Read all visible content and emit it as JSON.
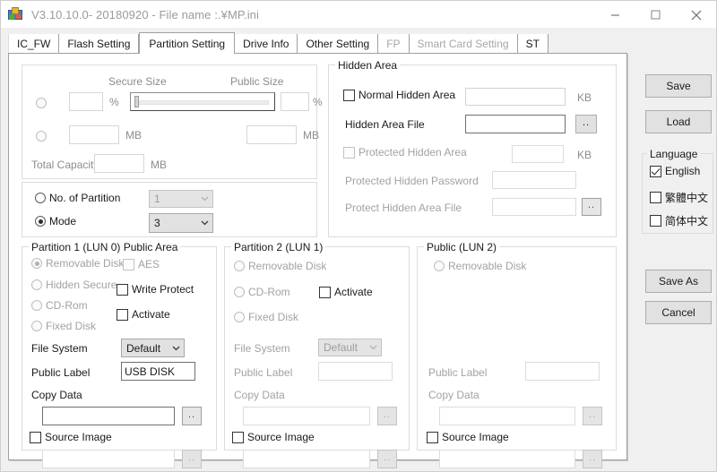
{
  "window": {
    "title": "V3.10.10.0- 20180920 - File name :.¥MP.ini",
    "app_icon": "usb-tool-icon",
    "minimize_label": "minimize-icon",
    "maximize_label": "maximize-icon",
    "close_label": "close-icon"
  },
  "tabs": [
    {
      "label": "IC_FW",
      "active": false,
      "disabled": false
    },
    {
      "label": "Flash Setting",
      "active": false,
      "disabled": false
    },
    {
      "label": "Partition Setting",
      "active": true,
      "disabled": false
    },
    {
      "label": "Drive Info",
      "active": false,
      "disabled": false
    },
    {
      "label": "Other Setting",
      "active": false,
      "disabled": false
    },
    {
      "label": "FP",
      "active": false,
      "disabled": true
    },
    {
      "label": "Smart Card Setting",
      "active": false,
      "disabled": true
    },
    {
      "label": "ST",
      "active": false,
      "disabled": false
    }
  ],
  "size_group": {
    "secure_size_label": "Secure Size",
    "public_size_label": "Public Size",
    "percent_unit": "%",
    "mb_unit": "MB",
    "secure_percent_value": "",
    "public_percent_value": "",
    "secure_mb_value": "",
    "public_mb_value": "",
    "total_capacity_label": "Total Capacity",
    "total_capacity_value": "",
    "total_capacity_unit": "MB",
    "slider_position_percent": 2
  },
  "partition_mode": {
    "no_of_partition_label": "No. of Partition",
    "no_of_partition_value": "1",
    "mode_label": "Mode",
    "mode_value": "3",
    "selected": "Mode"
  },
  "hidden_area": {
    "group_title": "Hidden Area",
    "normal_hidden_area_label": "Normal Hidden Area",
    "normal_hidden_area_checked": false,
    "normal_hidden_area_value": "",
    "normal_hidden_area_unit": "KB",
    "hidden_area_file_label": "Hidden Area File",
    "hidden_area_file_value": "",
    "browse_label": "..",
    "protected_hidden_area_label": "Protected Hidden Area",
    "protected_hidden_area_checked": false,
    "protected_hidden_area_value": "",
    "protected_hidden_area_unit": "KB",
    "protected_hidden_password_label": "Protected Hidden Password",
    "protected_hidden_password_value": "",
    "protect_hidden_area_file_label": "Protect Hidden Area File",
    "protect_hidden_area_file_value": ""
  },
  "partition1": {
    "group_title": "Partition 1 (LUN 0) Public Area",
    "radios": [
      {
        "label": "Removable Disk",
        "checked": true
      },
      {
        "label": "Hidden Secure",
        "checked": false
      },
      {
        "label": "CD-Rom",
        "checked": false
      },
      {
        "label": "Fixed Disk",
        "checked": false
      }
    ],
    "aes_label": "AES",
    "aes_checked": false,
    "write_protect_label": "Write Protect",
    "write_protect_checked": false,
    "activate_label": "Activate",
    "activate_checked": false,
    "file_system_label": "File System",
    "file_system_value": "Default",
    "public_label_label": "Public Label",
    "public_label_value": "USB DISK",
    "copy_data_label": "Copy Data",
    "copy_data_value": "",
    "source_image_label": "Source Image",
    "source_image_checked": false,
    "source_image_value": "",
    "browse_label": ".."
  },
  "partition2": {
    "group_title": "Partition 2 (LUN 1)",
    "radios": [
      {
        "label": "Removable Disk",
        "checked": false
      },
      {
        "label": "CD-Rom",
        "checked": false
      },
      {
        "label": "Fixed Disk",
        "checked": false
      }
    ],
    "activate_label": "Activate",
    "activate_checked": false,
    "file_system_label": "File System",
    "file_system_value": "Default",
    "public_label_label": "Public Label",
    "public_label_value": "",
    "copy_data_label": "Copy Data",
    "copy_data_value": "",
    "source_image_label": "Source Image",
    "source_image_checked": false,
    "source_image_value": "",
    "browse_label": ".."
  },
  "partition3": {
    "group_title": "Public (LUN 2)",
    "radios": [
      {
        "label": "Removable Disk",
        "checked": false
      }
    ],
    "public_label_label": "Public Label",
    "public_label_value": "",
    "copy_data_label": "Copy Data",
    "copy_data_value": "",
    "source_image_label": "Source Image",
    "source_image_checked": false,
    "source_image_value": "",
    "browse_label": ".."
  },
  "sidebar": {
    "save_label": "Save",
    "load_label": "Load",
    "language_group_title": "Language",
    "languages": [
      {
        "label": "English",
        "checked": true
      },
      {
        "label": "繁體中文",
        "checked": false
      },
      {
        "label": "简体中文",
        "checked": false
      }
    ],
    "save_as_label": "Save As",
    "cancel_label": "Cancel"
  }
}
